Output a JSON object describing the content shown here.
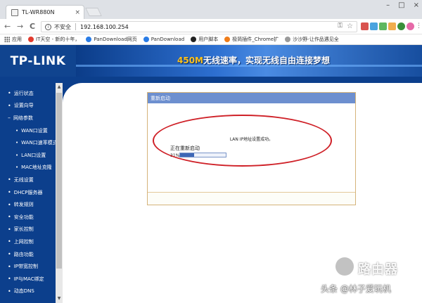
{
  "browser": {
    "tab_title": "TL-WR880N",
    "tab_close": "×",
    "win_buttons": [
      "–",
      "□",
      "×"
    ],
    "nav": {
      "back": "←",
      "forward": "→",
      "reload": "C"
    },
    "address": {
      "info": "i",
      "security": "不安全",
      "url": "192.168.100.254"
    },
    "bookmarks": [
      {
        "label": "应用",
        "color": "#555"
      },
      {
        "label": "IT天空 - 新的十年，",
        "color": "#e23b2e"
      },
      {
        "label": "PanDownload网页",
        "color": "#2a7ce6"
      },
      {
        "label": "PanDownload",
        "color": "#2a7ce6"
      },
      {
        "label": "用户脚本",
        "color": "#222"
      },
      {
        "label": "极简插件_Chrome扩",
        "color": "#ef7c19"
      },
      {
        "label": "沙沙野-让作品遇见全",
        "color": "#9a9a9a"
      }
    ],
    "extension_colors": [
      "#d9534f",
      "#4aa3df",
      "#5fb760",
      "#f0ad4e",
      "#3a8f3a",
      "#e66aa8",
      "#6b6bd0"
    ]
  },
  "router": {
    "logo": "TP-LINK",
    "slogan_speed": "450M",
    "slogan_text": "无线速率，实现无线自由连接梦想",
    "menu": [
      {
        "label": "运行状态",
        "kind": "top"
      },
      {
        "label": "设置向导",
        "kind": "top"
      },
      {
        "label": "网络参数",
        "kind": "open"
      },
      {
        "label": "WAN口设置",
        "kind": "sub"
      },
      {
        "label": "WAN口速率模式",
        "kind": "sub"
      },
      {
        "label": "LAN口设置",
        "kind": "sub"
      },
      {
        "label": "MAC地址克隆",
        "kind": "sub"
      },
      {
        "label": "无线设置",
        "kind": "top"
      },
      {
        "label": "DHCP服务器",
        "kind": "top"
      },
      {
        "label": "转发规则",
        "kind": "top"
      },
      {
        "label": "安全功能",
        "kind": "top"
      },
      {
        "label": "家长控制",
        "kind": "top"
      },
      {
        "label": "上网控制",
        "kind": "top"
      },
      {
        "label": "路由功能",
        "kind": "top"
      },
      {
        "label": "IP带宽控制",
        "kind": "top"
      },
      {
        "label": "IP与MAC绑定",
        "kind": "top"
      },
      {
        "label": "动态DNS",
        "kind": "top"
      }
    ],
    "panel": {
      "title": "重新启动",
      "message": "LAN IP地址设置成功。",
      "restarting": "正在重新启动",
      "percent_label": "31%",
      "progress": 0.31
    },
    "highlight_color": "#cf2027"
  },
  "watermark": {
    "brand": "路由器",
    "credit": "头条 @林子爱玩机"
  }
}
